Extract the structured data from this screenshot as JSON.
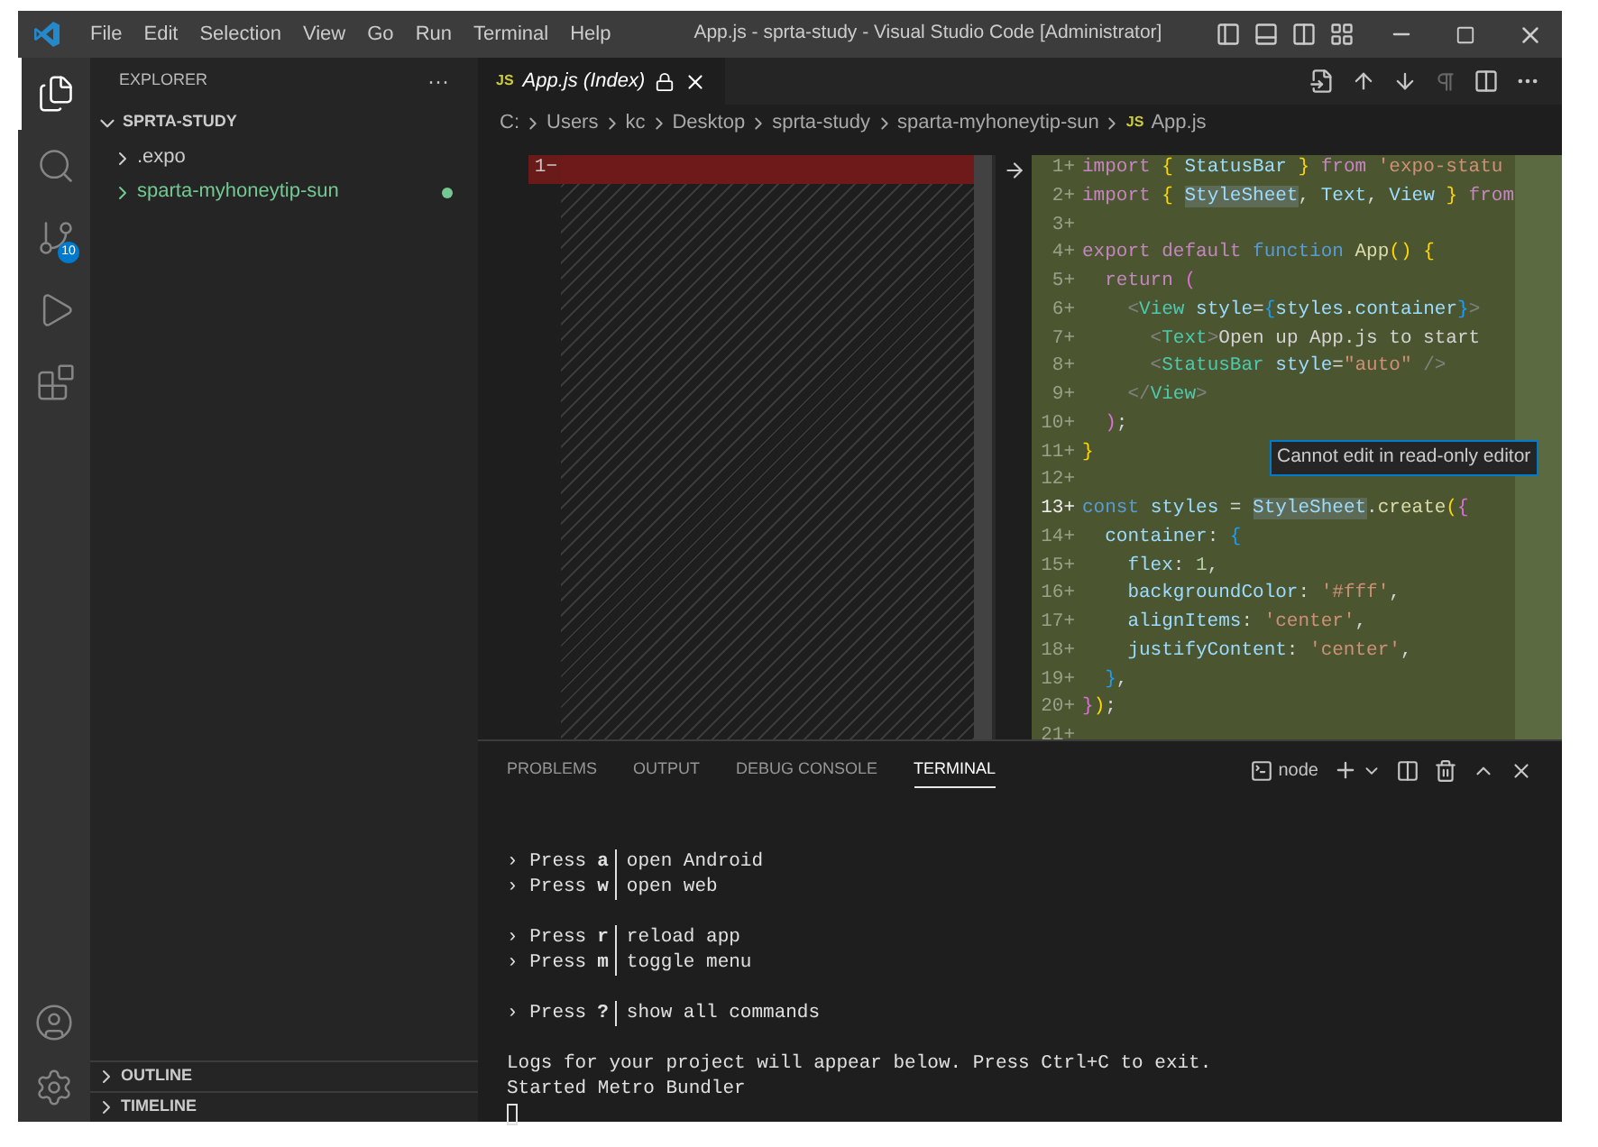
{
  "window": {
    "title": "App.js - sprta-study - Visual Studio Code [Administrator]"
  },
  "menu": [
    "File",
    "Edit",
    "Selection",
    "View",
    "Go",
    "Run",
    "Terminal",
    "Help"
  ],
  "activity_bar": {
    "top": [
      {
        "selected": true
      },
      {
        "selected": false
      },
      {
        "selected": false,
        "badge": "10"
      },
      {
        "selected": false
      },
      {
        "selected": false
      }
    ]
  },
  "sidebar": {
    "title": "EXPLORER",
    "more": "···",
    "folder": {
      "label": "SPRTA-STUDY",
      "expanded": true,
      "children": [
        {
          "label": ".expo",
          "expanded": false,
          "untracked": false
        },
        {
          "label": "sparta-myhoneytip-sun",
          "expanded": false,
          "untracked": true
        }
      ]
    },
    "sections": [
      {
        "label": "OUTLINE",
        "expanded": false
      },
      {
        "label": "TIMELINE",
        "expanded": false
      }
    ]
  },
  "tab": {
    "badge": "JS",
    "label": "App.js (Index)",
    "selected": true
  },
  "breadcrumb": [
    "C:",
    "Users",
    "kc",
    "Desktop",
    "sprta-study",
    "sparta-myhoneytip-sun"
  ],
  "breadcrumb_file": {
    "badge": "JS",
    "label": "App.js"
  },
  "diff": {
    "left": [
      {
        "number": "1−"
      }
    ],
    "right": [
      {
        "number": "1+",
        "tokens": [
          {
            "kind": "kw",
            "text": "import"
          },
          {
            "kind": "b1",
            "text": " {"
          },
          {
            "kind": "var",
            "text": " StatusBar"
          },
          {
            "kind": "b1",
            "text": " }"
          },
          {
            "kind": "kw",
            "text": " from"
          },
          {
            "kind": "str",
            "text": " 'expo-statu"
          }
        ]
      },
      {
        "number": "2+",
        "tokens": [
          {
            "kind": "kw",
            "text": "import"
          },
          {
            "kind": "b1",
            "text": " { "
          },
          {
            "kind": "var",
            "text": "StyleSheet",
            "highlight": true
          },
          {
            "kind": "plain",
            "text": ","
          },
          {
            "kind": "var",
            "text": " Text"
          },
          {
            "kind": "plain",
            "text": ","
          },
          {
            "kind": "var",
            "text": " View"
          },
          {
            "kind": "b1",
            "text": " }"
          },
          {
            "kind": "kw",
            "text": " from"
          }
        ]
      },
      {
        "number": "3+"
      },
      {
        "number": "4+",
        "tokens": [
          {
            "kind": "kw",
            "text": "export default"
          },
          {
            "kind": "storage",
            "text": " function"
          },
          {
            "kind": "fn",
            "text": " App"
          },
          {
            "kind": "b1",
            "text": "()"
          },
          {
            "kind": "b1",
            "text": " {"
          }
        ]
      },
      {
        "number": "5+",
        "tokens": [
          {
            "kind": "kw",
            "text": "  return"
          },
          {
            "kind": "b2",
            "text": " ("
          }
        ]
      },
      {
        "number": "6+",
        "tokens": [
          {
            "kind": "angle",
            "text": "    <"
          },
          {
            "kind": "tag",
            "text": "View"
          },
          {
            "kind": "var",
            "text": " style"
          },
          {
            "kind": "plain",
            "text": "="
          },
          {
            "kind": "b3",
            "text": "{"
          },
          {
            "kind": "var",
            "text": "styles"
          },
          {
            "kind": "plain",
            "text": "."
          },
          {
            "kind": "var",
            "text": "container"
          },
          {
            "kind": "b3",
            "text": "}"
          },
          {
            "kind": "angle",
            "text": ">"
          }
        ]
      },
      {
        "number": "7+",
        "tokens": [
          {
            "kind": "angle",
            "text": "      <"
          },
          {
            "kind": "tag",
            "text": "Text"
          },
          {
            "kind": "angle",
            "text": ">"
          },
          {
            "kind": "plain",
            "text": "Open up App.js to start"
          }
        ]
      },
      {
        "number": "8+",
        "tokens": [
          {
            "kind": "angle",
            "text": "      <"
          },
          {
            "kind": "tag",
            "text": "StatusBar"
          },
          {
            "kind": "var",
            "text": " style"
          },
          {
            "kind": "plain",
            "text": "="
          },
          {
            "kind": "str",
            "text": "\"auto\""
          },
          {
            "kind": "angle",
            "text": " />"
          }
        ]
      },
      {
        "number": "9+",
        "tokens": [
          {
            "kind": "angle",
            "text": "    </"
          },
          {
            "kind": "tag",
            "text": "View"
          },
          {
            "kind": "angle",
            "text": ">"
          }
        ]
      },
      {
        "number": "10+",
        "tokens": [
          {
            "kind": "b2",
            "text": "  )"
          },
          {
            "kind": "plain",
            "text": ";"
          }
        ]
      },
      {
        "number": "11+",
        "tokens": [
          {
            "kind": "b1",
            "text": "}"
          }
        ]
      },
      {
        "number": "12+"
      },
      {
        "number": "13+",
        "current": true,
        "tokens": [
          {
            "kind": "storage",
            "text": "const"
          },
          {
            "kind": "var",
            "text": " styles"
          },
          {
            "kind": "plain",
            "text": " = "
          },
          {
            "kind": "var",
            "text": "StyleSheet",
            "highlight": true
          },
          {
            "kind": "plain",
            "text": "."
          },
          {
            "kind": "fn",
            "text": "create"
          },
          {
            "kind": "b1",
            "text": "("
          },
          {
            "kind": "b2",
            "text": "{"
          }
        ]
      },
      {
        "number": "14+",
        "tokens": [
          {
            "kind": "var",
            "text": "  container"
          },
          {
            "kind": "plain",
            "text": ": "
          },
          {
            "kind": "b3",
            "text": "{"
          }
        ]
      },
      {
        "number": "15+",
        "tokens": [
          {
            "kind": "var",
            "text": "    flex"
          },
          {
            "kind": "plain",
            "text": ": "
          },
          {
            "kind": "num",
            "text": "1"
          },
          {
            "kind": "plain",
            "text": ","
          }
        ]
      },
      {
        "number": "16+",
        "tokens": [
          {
            "kind": "var",
            "text": "    backgroundColor"
          },
          {
            "kind": "plain",
            "text": ": "
          },
          {
            "kind": "str",
            "text": "'#fff'"
          },
          {
            "kind": "plain",
            "text": ","
          }
        ]
      },
      {
        "number": "17+",
        "tokens": [
          {
            "kind": "var",
            "text": "    alignItems"
          },
          {
            "kind": "plain",
            "text": ": "
          },
          {
            "kind": "str",
            "text": "'center'"
          },
          {
            "kind": "plain",
            "text": ","
          }
        ]
      },
      {
        "number": "18+",
        "tokens": [
          {
            "kind": "var",
            "text": "    justifyContent"
          },
          {
            "kind": "plain",
            "text": ": "
          },
          {
            "kind": "str",
            "text": "'center'"
          },
          {
            "kind": "plain",
            "text": ","
          }
        ]
      },
      {
        "number": "19+",
        "tokens": [
          {
            "kind": "b3",
            "text": "  }"
          },
          {
            "kind": "plain",
            "text": ","
          }
        ]
      },
      {
        "number": "20+",
        "tokens": [
          {
            "kind": "b2",
            "text": "}"
          },
          {
            "kind": "b1",
            "text": ")"
          },
          {
            "kind": "plain",
            "text": ";"
          }
        ]
      },
      {
        "number": "21+"
      }
    ]
  },
  "tooltip": "Cannot edit in read-only editor",
  "panel": {
    "tabs": [
      {
        "label": "PROBLEMS",
        "selected": false
      },
      {
        "label": "OUTPUT",
        "selected": false
      },
      {
        "label": "DEBUG CONSOLE",
        "selected": false
      },
      {
        "label": "TERMINAL",
        "selected": true
      }
    ],
    "terminal_name": "node",
    "lines": [
      {
        "kind": "blank"
      },
      {
        "kind": "blank"
      },
      {
        "kind": "command",
        "prefix": "› Press",
        "key": "a",
        "action": "open Android"
      },
      {
        "kind": "command",
        "prefix": "› Press",
        "key": "w",
        "action": "open web"
      },
      {
        "kind": "blank"
      },
      {
        "kind": "command",
        "prefix": "› Press",
        "key": "r",
        "action": "reload app"
      },
      {
        "kind": "command",
        "prefix": "› Press",
        "key": "m",
        "action": "toggle menu"
      },
      {
        "kind": "blank"
      },
      {
        "kind": "command",
        "prefix": "› Press",
        "key": "?",
        "action": "show all commands"
      },
      {
        "kind": "blank"
      },
      {
        "kind": "text",
        "text": "Logs for your project will appear below. Press Ctrl+C to exit."
      },
      {
        "kind": "text",
        "text": "Started Metro Bundler"
      },
      {
        "kind": "cursor"
      }
    ]
  }
}
